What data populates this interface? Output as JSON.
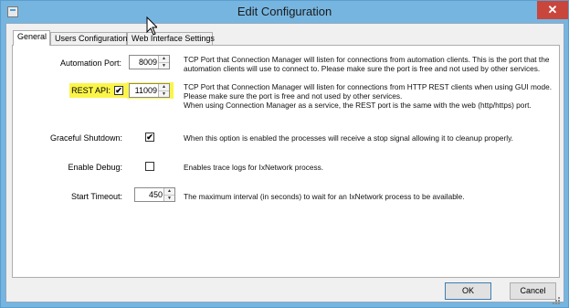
{
  "window": {
    "title": "Edit Configuration",
    "close_glyph": "✕"
  },
  "tabs": [
    {
      "label": "General"
    },
    {
      "label": "Users Configuration"
    },
    {
      "label": "Web Interface Settings"
    }
  ],
  "general": {
    "automation_port": {
      "label": "Automation Port:",
      "value": "8009",
      "desc_lines": [
        "TCP Port that Connection Manager will listen for connections from automation clients. This is the port that the",
        "automation clients will use to connect to.  Please make sure the port is free and not used by other services."
      ]
    },
    "rest_api": {
      "label": "REST API:",
      "checked": true,
      "value": "11009",
      "highlight_color": "#fbf54a",
      "desc_lines": [
        "TCP Port that Connection Manager will listen for connections from HTTP REST clients when using GUI mode.",
        "Please make sure the port is free and not used by other services.",
        "When using Connection Manager as a service, the REST port is the same with the web (http/https) port."
      ]
    },
    "graceful_shutdown": {
      "label": "Graceful Shutdown:",
      "checked": true,
      "desc": "When this option is enabled the processes will receive a stop signal allowing it to cleanup properly."
    },
    "enable_debug": {
      "label": "Enable Debug:",
      "checked": false,
      "desc": "Enables trace logs for IxNetwork process."
    },
    "start_timeout": {
      "label": "Start Timeout:",
      "value": "450",
      "desc": "The maximum interval (in seconds) to wait for an IxNetwork process to be available."
    }
  },
  "buttons": {
    "ok": "OK",
    "cancel": "Cancel"
  },
  "glyphs": {
    "check": "✔",
    "spin_up": "▲",
    "spin_down": "▼"
  },
  "colors": {
    "title_bar": "#76b5e0",
    "close_button": "#c9463d",
    "highlight": "#fbf54a"
  }
}
